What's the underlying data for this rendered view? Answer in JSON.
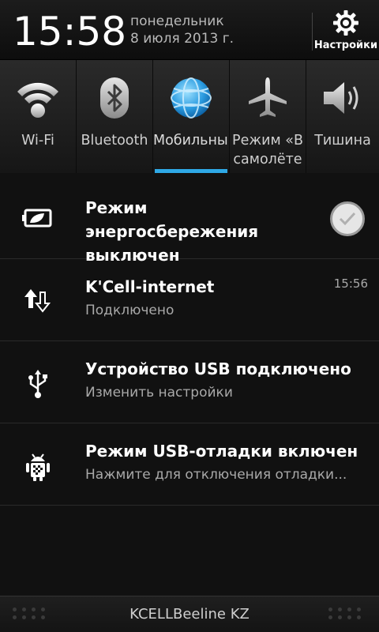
{
  "header": {
    "time": "15:58",
    "weekday": "понедельник",
    "date": "8 июля 2013 г.",
    "settings_label": "Настройки"
  },
  "toggles": [
    {
      "label": "Wi-Fi",
      "icon": "wifi-icon",
      "active": false
    },
    {
      "label": "Bluetooth",
      "icon": "bluetooth-icon",
      "active": false
    },
    {
      "label": "Мобильный",
      "icon": "globe-icon",
      "active": true
    },
    {
      "label": "Режим «В самолёте",
      "icon": "airplane-icon",
      "active": false
    },
    {
      "label": "Тишина",
      "icon": "speaker-icon",
      "active": false
    }
  ],
  "notifications": [
    {
      "title": "Режим энергосбережения выключен",
      "icon": "battery-leaf-icon"
    },
    {
      "title": "K'Cell-internet",
      "subtitle": "Подключено",
      "time": "15:56",
      "icon": "data-arrows-icon"
    },
    {
      "title": "Устройство USB подключено",
      "subtitle": "Изменить настройки",
      "icon": "usb-icon"
    },
    {
      "title": "Режим USB-отладки включен",
      "subtitle": "Нажмите для отключения отладки...",
      "icon": "android-debug-icon"
    }
  ],
  "footer": {
    "carrier": "KCELLBeeline KZ"
  },
  "colors": {
    "accent": "#2fa9e6",
    "background": "#111111"
  }
}
